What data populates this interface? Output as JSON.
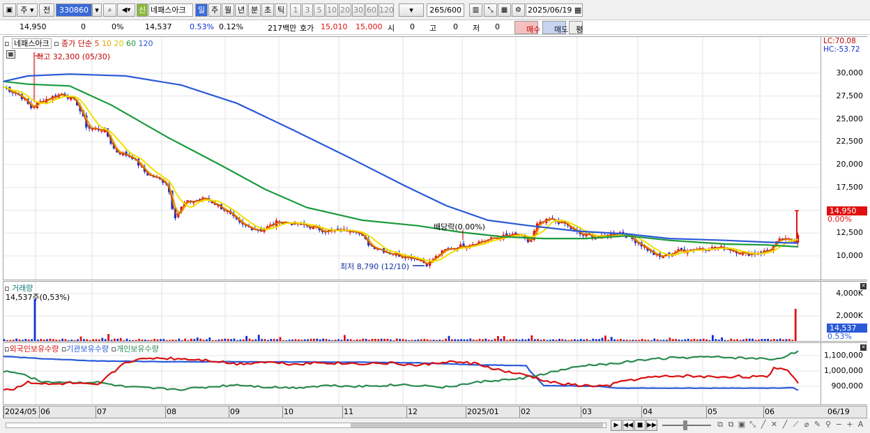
{
  "toolbar": {
    "mode": "주",
    "type_btn": "전",
    "code": "330860",
    "sin_label": "신",
    "stock_name": "네패스아크",
    "periods": [
      "일",
      "주",
      "월",
      "년",
      "분",
      "초",
      "틱"
    ],
    "active_period": "일",
    "intervals": [
      "1",
      "3",
      "5",
      "10",
      "20",
      "30",
      "60",
      "120"
    ],
    "count": "265",
    "count_max": "/600",
    "date": "2025/06/19"
  },
  "quote": {
    "price": "14,950",
    "change": "0",
    "change_pct": "0%",
    "prev_price": "14,537",
    "vol_pct": "0.53%",
    "rate": "0.12%",
    "amount": "217백만",
    "ask_label": "호가",
    "ask1": "15,010",
    "ask2": "15,000",
    "open_label": "시",
    "open_val": "0",
    "high_label": "고",
    "high_val": "0",
    "low_label": "저",
    "low_val": "0",
    "buy_label": "매수",
    "sell_label": "매도",
    "eval_label": "평"
  },
  "price_pane": {
    "name": "네패스아크",
    "legend_title": "종가 단순",
    "ma": [
      {
        "label": "5",
        "color": "#d4480a"
      },
      {
        "label": "10",
        "color": "#e8a000"
      },
      {
        "label": "20",
        "color": "#d8c800"
      },
      {
        "label": "60",
        "color": "#1a9a3a"
      },
      {
        "label": "120",
        "color": "#2a5ad8"
      }
    ],
    "lc": "LC:70.08",
    "hc": "HC:-53.72",
    "ticks": [
      "30,000",
      "27,500",
      "25,000",
      "22,500",
      "20,000",
      "17,500",
      "15,000",
      "12,500",
      "10,000"
    ],
    "last_price": "14,950",
    "last_pct": "0.00%",
    "annot_high": "최고 32,300 (05/30)",
    "annot_low": "최저 8,790 (12/10)",
    "annot_div": "배당락(0.00%)"
  },
  "volume_pane": {
    "title": "거래량",
    "value": "14,537주(0,53%)",
    "ticks": [
      "4,000K",
      "2,000K"
    ],
    "last_vol": "14,537",
    "last_pct": "0.53%"
  },
  "holding_pane": {
    "series": [
      {
        "name": "외국인보유수량",
        "color": "#d81010"
      },
      {
        "name": "기관보유수량",
        "color": "#2a5ad8"
      },
      {
        "name": "개인보유수량",
        "color": "#2a8a50"
      }
    ],
    "ticks": [
      "1,100,000",
      "1,000,000",
      "900,000"
    ]
  },
  "dates": [
    "2024/05",
    "06",
    "07",
    "08",
    "09",
    "10",
    "11",
    "12",
    "2025/01",
    "02",
    "03",
    "04",
    "05",
    "06",
    "06/19"
  ],
  "colors": {
    "up": "#e01010",
    "down": "#1030d0",
    "ma5": "#d4480a",
    "ma10": "#e8a000",
    "ma20": "#f0e000",
    "ma60": "#1a9a3a",
    "ma120": "#2a5ad8"
  },
  "chart_data": {
    "type": "line",
    "title": "네패스아크 일봉",
    "x_range": [
      "2024/05",
      "2025/06/19"
    ],
    "y_range": [
      8790,
      32300
    ],
    "points": [
      [
        "2024/05",
        28500
      ],
      [
        "2024/06",
        27000
      ],
      [
        "2024/07",
        23500
      ],
      [
        "2024/08",
        16500
      ],
      [
        "2024/09",
        13500
      ],
      [
        "2024/10",
        13800
      ],
      [
        "2024/11",
        12500
      ],
      [
        "2024/12",
        9500
      ],
      [
        "2025/01",
        10800
      ],
      [
        "2025/02",
        12000
      ],
      [
        "2025/03",
        12500
      ],
      [
        "2025/04",
        10000
      ],
      [
        "2025/05",
        10500
      ],
      [
        "2025/06",
        11500
      ],
      [
        "2025/06/19",
        14950
      ]
    ]
  }
}
